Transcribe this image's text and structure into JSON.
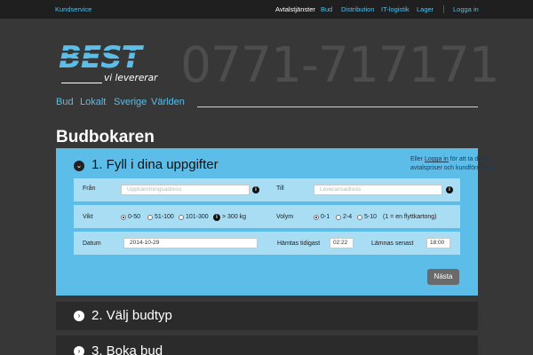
{
  "topbar": {
    "customer_service": "Kundservice",
    "nav": [
      "Avtalstjänster",
      "Bud",
      "Distribution",
      "IT-logistik",
      "Lager"
    ],
    "login": "Logga in"
  },
  "header": {
    "logo_text": "BEST",
    "tagline": "vi levererar",
    "phone": "0771-717171"
  },
  "service_tabs": [
    "Bud",
    "Lokalt",
    "Sverige",
    "Världen"
  ],
  "page_title": "Budbokaren",
  "step1": {
    "title": "1. Fyll i dina uppgifter",
    "login_note": {
      "prefix": "Eller",
      "link": "Logga in",
      "suffix": "för att ta del av",
      "line2": "avtalspriser och kundförmåner"
    },
    "from_label": "Från",
    "from_placeholder": "Upphämtningsadress",
    "to_label": "Till",
    "to_placeholder": "Leveransadress",
    "weight_label": "Vikt",
    "weight_options": [
      "0-50",
      "51-100",
      "101-300",
      "> 300 kg"
    ],
    "weight_selected": "0-50",
    "volume_label": "Volym",
    "volume_options": [
      "0-1",
      "2-4",
      "5-10"
    ],
    "volume_note": "(1 = en flyttkartong)",
    "volume_selected": "0-1",
    "date_label": "Datum",
    "date_value": "2014-10-29",
    "pickup_label": "Hämtas tidigast",
    "pickup_value": "02:22",
    "dropoff_label": "Lämnas senast",
    "dropoff_value": "18:00",
    "next_label": "Nästa"
  },
  "step2": {
    "title": "2. Välj budtyp"
  },
  "step3": {
    "title": "3. Boka bud"
  },
  "colors": {
    "accent": "#5bbde8",
    "row": "#a8ddf4",
    "dark": "#373737"
  }
}
